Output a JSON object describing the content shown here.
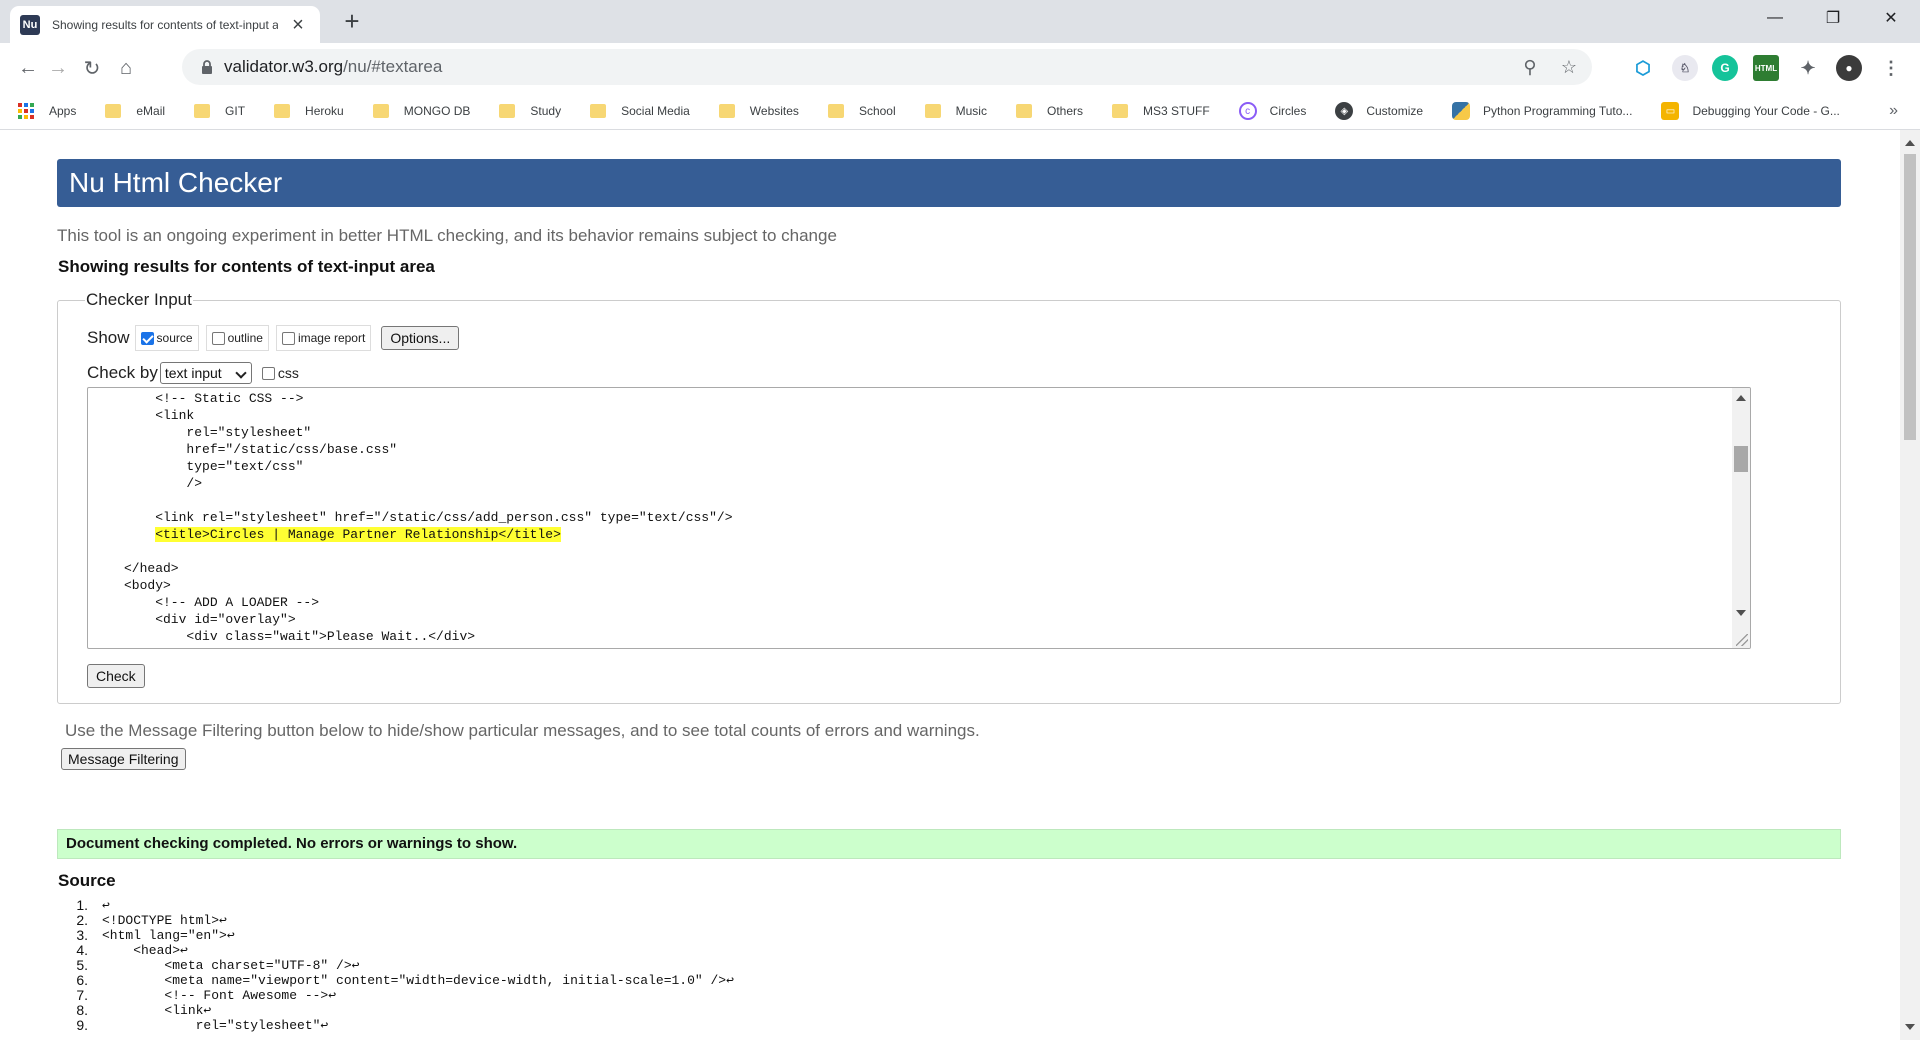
{
  "browser": {
    "tab_title": "Showing results for contents of text-input area",
    "url_host": "validator.w3.org",
    "url_path": "/nu/#textarea",
    "bookmarks": [
      "Apps",
      "eMail",
      "GIT",
      "Heroku",
      "MONGO DB",
      "Study",
      "Social Media",
      "Websites",
      "School",
      "Music",
      "Others",
      "MS3 STUFF",
      "Circles",
      "Customize",
      "Python Programming Tuto...",
      "Debugging Your Code - G..."
    ]
  },
  "page": {
    "banner": "Nu Html Checker",
    "subtitle": "This tool is an ongoing experiment in better HTML checking, and its behavior remains subject to change",
    "results_heading": "Showing results for contents of text-input area",
    "legend": "Checker Input",
    "show_label": "Show",
    "opt_source": "source",
    "opt_outline": "outline",
    "opt_image_report": "image report",
    "options_button": "Options...",
    "check_by_label": "Check by",
    "check_by_value": "text input",
    "css_label": "css",
    "textarea_lines": [
      "    <!-- Static CSS -->",
      "    <link",
      "        rel=\"stylesheet\"",
      "        href=\"/static/css/base.css\"",
      "        type=\"text/css\"",
      "        />",
      "",
      "    <link rel=\"stylesheet\" href=\"/static/css/add_person.css\" type=\"text/css\"/>",
      "    <title>Circles | Manage Partner Relationship</title>",
      "",
      "</head>",
      "<body>",
      "    <!-- ADD A LOADER -->",
      "    <div id=\"overlay\">",
      "        <div class=\"wait\">Please Wait..</div>"
    ],
    "check_button": "Check",
    "filter_note": "Use the Message Filtering button below to hide/show particular messages, and to see total counts of errors and warnings.",
    "filter_button": "Message Filtering",
    "success_message": "Document checking completed. No errors or warnings to show.",
    "source_heading": "Source",
    "source_lines": [
      {
        "num": "1.",
        "text": "↩"
      },
      {
        "num": "2.",
        "text": "<!DOCTYPE html>↩"
      },
      {
        "num": "3.",
        "text": "<html lang=\"en\">↩"
      },
      {
        "num": "4.",
        "text": "    <head>↩"
      },
      {
        "num": "5.",
        "text": "        <meta charset=\"UTF-8\" />↩"
      },
      {
        "num": "6.",
        "text": "        <meta name=\"viewport\" content=\"width=device-width, initial-scale=1.0\" />↩"
      },
      {
        "num": "7.",
        "text": "        <!-- Font Awesome -->↩"
      },
      {
        "num": "8.",
        "text": "        <link↩"
      },
      {
        "num": "9.",
        "text": "            rel=\"stylesheet\"↩"
      }
    ]
  },
  "colors": {
    "banner": "#365d95",
    "success_bg": "#ccffcc",
    "highlight": "#ffff33"
  }
}
